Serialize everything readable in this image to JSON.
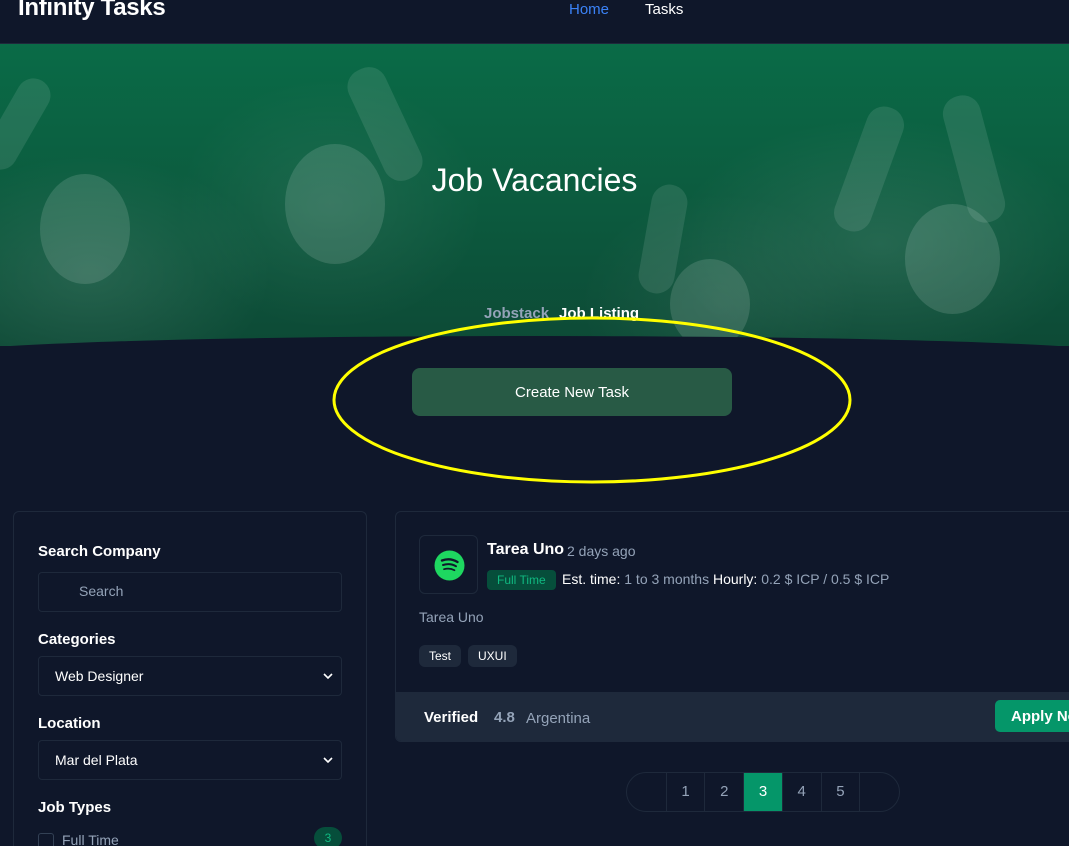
{
  "navbar": {
    "brand": "Infinity Tasks",
    "links": [
      {
        "label": "Home",
        "active": true
      },
      {
        "label": "Tasks",
        "active": false
      }
    ]
  },
  "hero": {
    "title": "Job Vacancies",
    "breadcrumb": [
      "Jobstack",
      "Job Listing"
    ]
  },
  "actions": {
    "create_task_label": "Create New Task"
  },
  "sidebar": {
    "search_company_label": "Search Company",
    "search_placeholder": "Search",
    "categories_label": "Categories",
    "category_selected": "Web Designer",
    "location_label": "Location",
    "location_selected": "Mar del Plata",
    "job_types_label": "Job Types",
    "job_types": [
      {
        "label": "Full Time",
        "count": "3",
        "checked": false
      }
    ]
  },
  "jobs": [
    {
      "title": "Tarea Uno",
      "posted": "2 days ago",
      "type": "Full Time",
      "est_time_label": "Est. time:",
      "est_time": "1 to 3 months",
      "hourly_label": "Hourly:",
      "hourly": "0.2 $ ICP / 0.5 $ ICP",
      "description": "Tarea Uno",
      "tags": [
        "Test",
        "UXUI"
      ],
      "verified_label": "Verified",
      "rating": "4.8",
      "country": "Argentina",
      "apply_label": "Apply Now",
      "logo_icon": "spotify-icon"
    }
  ],
  "pagination": {
    "pages": [
      "1",
      "2",
      "3",
      "4",
      "5"
    ],
    "current": "3"
  },
  "colors": {
    "background": "#0f172a",
    "accent": "#059669",
    "link_active": "#3b82f6",
    "highlight": "#ffff00"
  }
}
